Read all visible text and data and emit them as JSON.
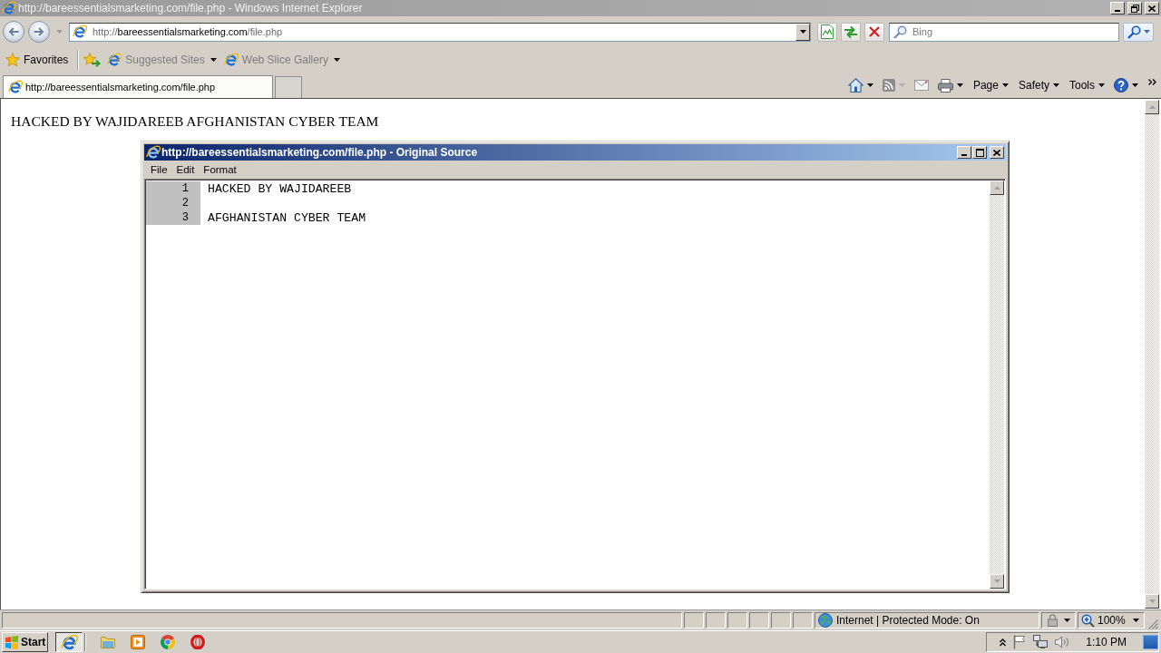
{
  "window": {
    "title": "http://bareessentialsmarketing.com/file.php - Windows Internet Explorer"
  },
  "address_bar": {
    "url": {
      "scheme": "http://",
      "host": "bareessentialsmarketing.com",
      "path": "/file.php"
    }
  },
  "search": {
    "placeholder": "Bing"
  },
  "favorites_bar": {
    "favorites": "Favorites",
    "items": [
      {
        "label": "Suggested Sites",
        "disabled": true
      },
      {
        "label": "Web Slice Gallery",
        "disabled": true
      }
    ]
  },
  "tabs": [
    {
      "label": "http://bareessentialsmarketing.com/file.php",
      "selected": true
    }
  ],
  "command_bar": {
    "feeds": {
      "disabled": true
    },
    "menus": [
      {
        "label": "Page"
      },
      {
        "label": "Safety"
      },
      {
        "label": "Tools"
      }
    ]
  },
  "page": {
    "heading": "HACKED BY WAJIDAREEB AFGHANISTAN CYBER TEAM"
  },
  "source_window": {
    "title": "http://bareessentialsmarketing.com/file.php - Original Source",
    "menu": [
      "File",
      "Edit",
      "Format"
    ],
    "lines": [
      {
        "number": "1",
        "text": "HACKED BY WAJIDAREEB"
      },
      {
        "number": "2"
      },
      {
        "number": "3",
        "text": "AFGHANISTAN CYBER TEAM"
      }
    ]
  },
  "status_bar": {
    "zone": "Internet | Protected Mode: On",
    "zoom": "100%"
  },
  "taskbar": {
    "start": "Start",
    "browser_button": {
      "selected": true
    },
    "clock": "1:10 PM"
  }
}
